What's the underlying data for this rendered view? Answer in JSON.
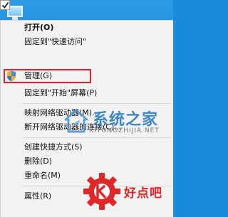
{
  "menu": {
    "items": [
      {
        "label": "打开(O)",
        "bold": true
      },
      {
        "label": "固定到\"快速访问\""
      },
      {
        "label": "管理(G)",
        "icon": "shield-icon",
        "highlighted": true
      },
      {
        "label": "固定到\"开始\"屏幕(P)"
      },
      {
        "label": "映射网络驱动器(M)..."
      },
      {
        "label": "断开网络驱动器的连接(C)..."
      },
      {
        "label": "创建快捷方式(S)"
      },
      {
        "label": "删除(D)"
      },
      {
        "label": "重命名(M)"
      },
      {
        "label": "属性(R)"
      }
    ]
  },
  "watermark": {
    "site": "系统之家",
    "site_domain": "XITONGZHIJIA.NET",
    "brand": "好点吧"
  },
  "colors": {
    "desktop": "#1a8bd8",
    "menu_bg": "#f2f2f2",
    "highlight_border": "#e5212c",
    "watermark_blue": "#3f88c7",
    "brand_red": "#e02626"
  }
}
